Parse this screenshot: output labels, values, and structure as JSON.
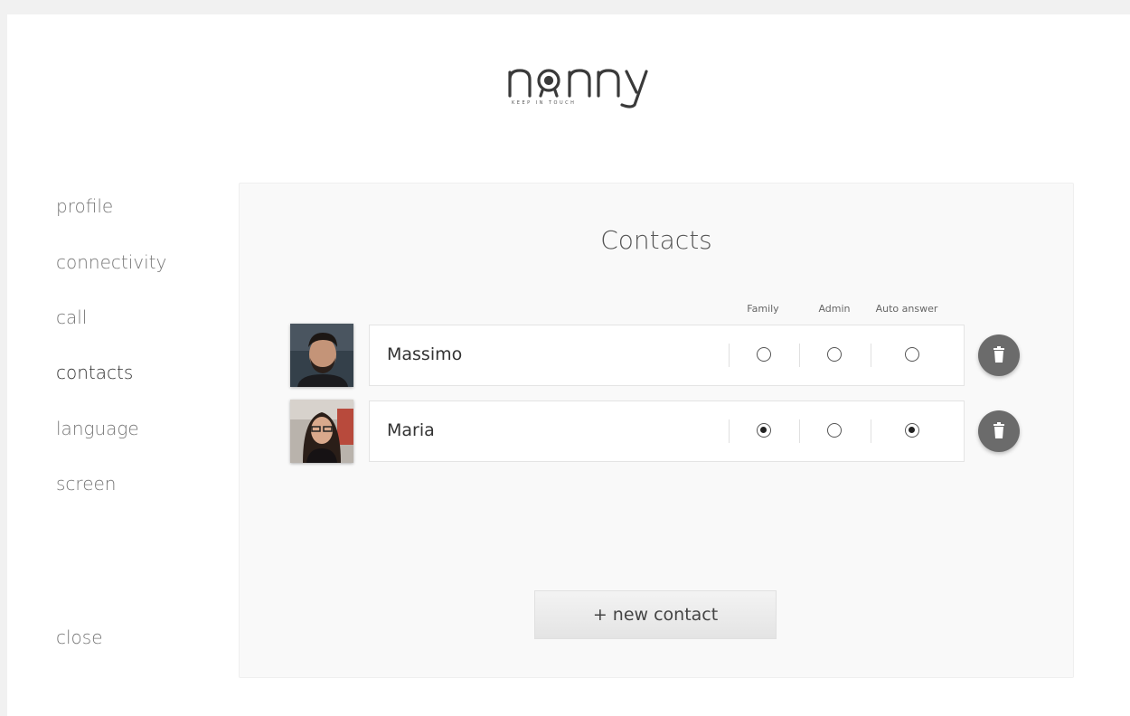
{
  "brand": {
    "name": "nonny",
    "tagline": "KEEP IN TOUCH"
  },
  "nav": {
    "items": [
      {
        "label": "profile",
        "active": false
      },
      {
        "label": "connectivity",
        "active": false
      },
      {
        "label": "call",
        "active": false
      },
      {
        "label": "contacts",
        "active": true
      },
      {
        "label": "language",
        "active": false
      },
      {
        "label": "screen",
        "active": false
      }
    ],
    "close_label": "close"
  },
  "panel": {
    "title": "Contacts",
    "columns": [
      "Family",
      "Admin",
      "Auto answer"
    ],
    "contacts": [
      {
        "name": "Massimo",
        "family": false,
        "admin": false,
        "auto_answer": false,
        "avatar": "man-portrait"
      },
      {
        "name": "Maria",
        "family": true,
        "admin": false,
        "auto_answer": true,
        "avatar": "woman-portrait"
      }
    ],
    "new_contact_label": "+ new contact",
    "delete_icon": "trash-icon"
  }
}
